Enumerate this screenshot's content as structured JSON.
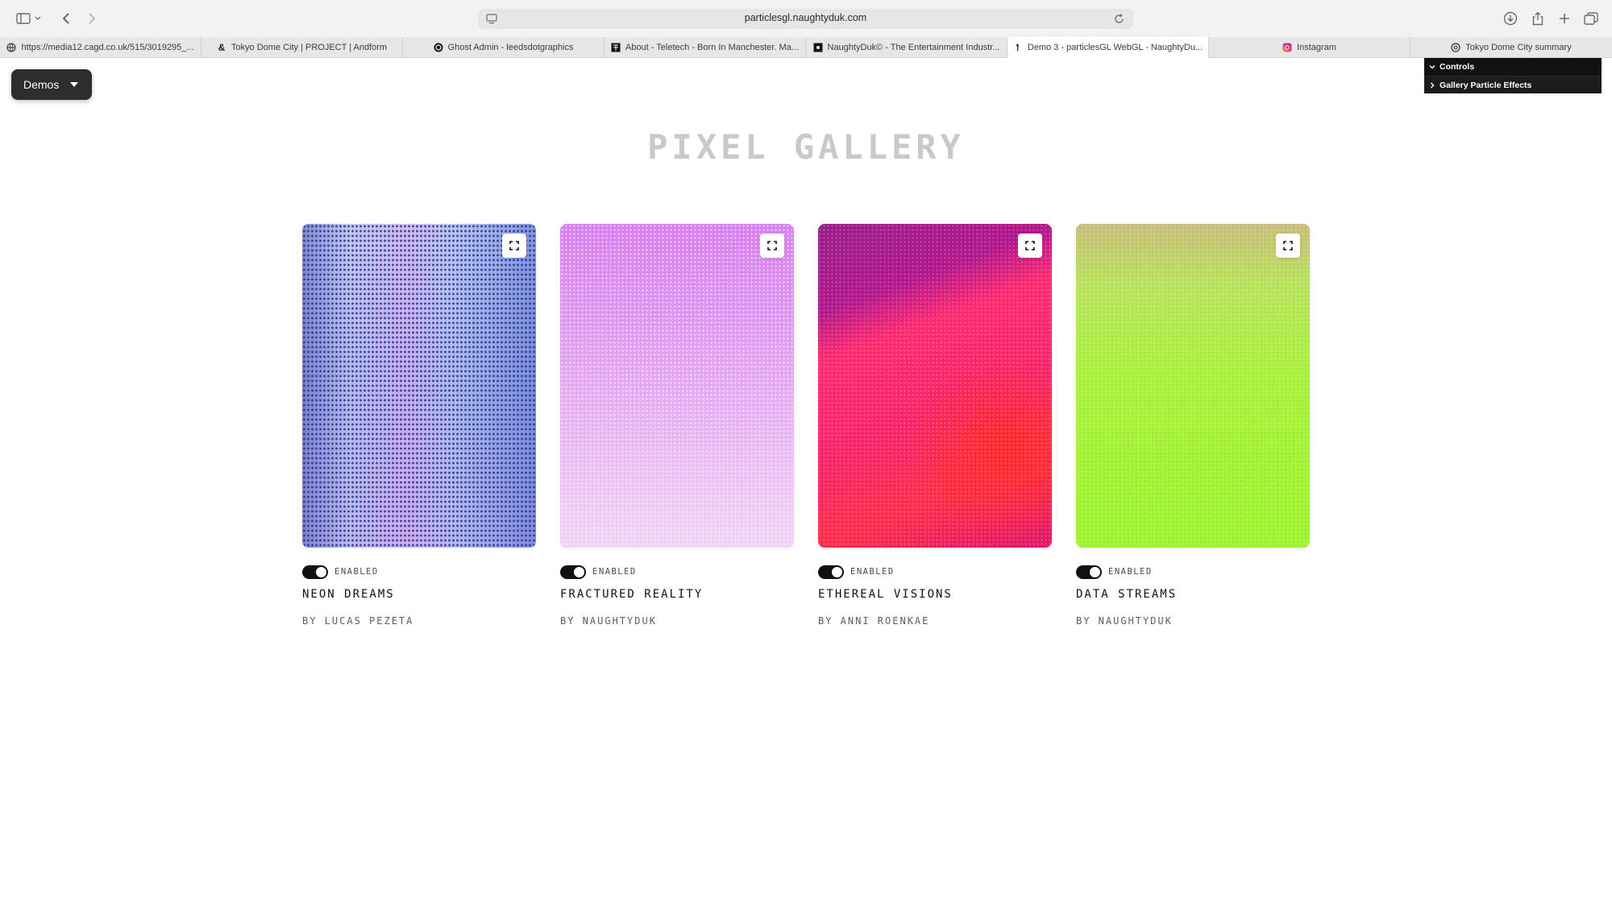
{
  "browser": {
    "url": "particlesgl.naughtyduk.com",
    "tabs": [
      {
        "label": "https://media12.cagd.co.uk/515/3019295_...",
        "icon": "globe-icon",
        "active": false
      },
      {
        "label": "Tokyo Dome City | PROJECT | Andform",
        "icon": "ampersand-icon",
        "active": false
      },
      {
        "label": "Ghost Admin - leedsdotgraphics",
        "icon": "ghost-icon",
        "active": false
      },
      {
        "label": "About - Teletech - Born In Manchester. Ma...",
        "icon": "teletech-icon",
        "active": false
      },
      {
        "label": "NaughtyDuk© - The Entertainment Industr...",
        "icon": "naughtyduk-icon",
        "active": false
      },
      {
        "label": "Demo 3 - particlesGL WebGL - NaughtyDu...",
        "icon": "duck-icon",
        "active": true
      },
      {
        "label": "Instagram",
        "icon": "instagram-icon",
        "active": false
      },
      {
        "label": "Tokyo Dome City summary",
        "icon": "openai-icon",
        "active": false
      }
    ]
  },
  "demos_menu": {
    "label": "Demos"
  },
  "controls_panel": {
    "title": "Controls",
    "folder": "Gallery Particle Effects"
  },
  "page": {
    "title": "PIXEL GALLERY",
    "cards": [
      {
        "title": "NEON DREAMS",
        "author": "BY LUCAS PEZETA",
        "toggle_label": "ENABLED",
        "enabled": true,
        "accent": "#3a4bb0"
      },
      {
        "title": "FRACTURED REALITY",
        "author": "BY NAUGHTYDUK",
        "toggle_label": "ENABLED",
        "enabled": true,
        "accent": "#dd8ff1"
      },
      {
        "title": "ETHEREAL VISIONS",
        "author": "BY ANNI ROENKAE",
        "toggle_label": "ENABLED",
        "enabled": true,
        "accent": "#f82467"
      },
      {
        "title": "DATA STREAMS",
        "author": "BY NAUGHTYDUK",
        "toggle_label": "ENABLED",
        "enabled": true,
        "accent": "#9cf32a"
      }
    ]
  }
}
